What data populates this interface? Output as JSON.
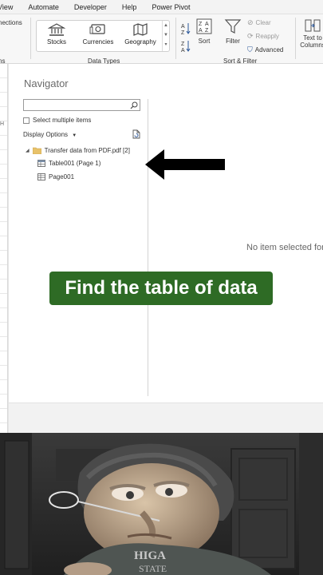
{
  "menubar": {
    "items": [
      "View",
      "Automate",
      "Developer",
      "Help",
      "Power Pivot"
    ]
  },
  "ribbon": {
    "left_fragments": [
      "nections",
      "ns"
    ],
    "data_types": {
      "buttons": [
        "Stocks",
        "Currencies",
        "Geography"
      ],
      "group_label": "Data Types"
    },
    "sort_filter": {
      "sort_label": "Sort",
      "filter_label": "Filter",
      "clear_label": "Clear",
      "reapply_label": "Reapply",
      "advanced_label": "Advanced",
      "group_label": "Sort & Filter"
    },
    "text_to_columns": {
      "line1": "Text to",
      "line2": "Columns"
    }
  },
  "sheet": {
    "col_header": "H"
  },
  "navigator": {
    "title": "Navigator",
    "search_placeholder": "",
    "select_multiple_label": "Select multiple items",
    "display_options_label": "Display Options",
    "tree_root_label": "Transfer data from PDF.pdf [2]",
    "tree_items": [
      "Table001 (Page 1)",
      "Page001"
    ],
    "preview_empty": "No item selected for preview"
  },
  "overlay": {
    "caption": "Find the table of data"
  },
  "colors": {
    "caption_bg": "#2e6b25",
    "arrow": "#000000",
    "folder": "#e8c26a"
  }
}
